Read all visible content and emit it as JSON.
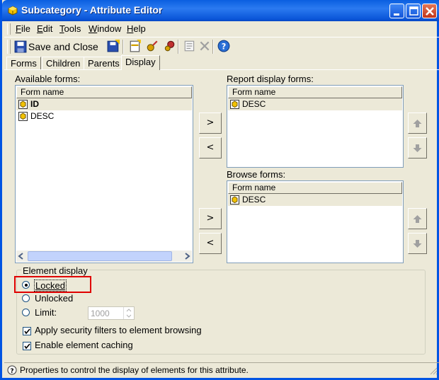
{
  "window": {
    "title": "Subcategory - Attribute Editor",
    "title_icon": "cube-icon",
    "controls": [
      "minimize-icon",
      "maximize-icon",
      "close-icon"
    ]
  },
  "menubar": {
    "items": [
      {
        "label": "File",
        "mnemonic": "F"
      },
      {
        "label": "Edit",
        "mnemonic": "E"
      },
      {
        "label": "Tools",
        "mnemonic": "T"
      },
      {
        "label": "Window",
        "mnemonic": "W"
      },
      {
        "label": "Help",
        "mnemonic": "H"
      }
    ]
  },
  "toolbar": {
    "save_close_label": "Save and Close",
    "icons": [
      "save-icon",
      "save-as-icon",
      "new-form-icon",
      "attribute-icon",
      "relationship-icon",
      "properties-icon",
      "delete-icon",
      "help-icon"
    ]
  },
  "tabs": [
    {
      "label": "Forms"
    },
    {
      "label": "Children"
    },
    {
      "label": "Parents"
    },
    {
      "label": "Display",
      "active": true
    }
  ],
  "available_forms": {
    "label": "Available forms:",
    "column": "Form name",
    "rows": [
      {
        "name": "ID",
        "selected": true,
        "bold": true
      },
      {
        "name": "DESC",
        "selected": false,
        "bold": false
      }
    ]
  },
  "report_display_forms": {
    "label": "Report display forms:",
    "column": "Form name",
    "rows": [
      {
        "name": "DESC",
        "selected": true
      }
    ]
  },
  "browse_forms": {
    "label": "Browse forms:",
    "column": "Form name",
    "rows": [
      {
        "name": "DESC",
        "selected": true
      }
    ]
  },
  "buttons": {
    "add_report": ">",
    "remove_report": "<",
    "add_browse": ">",
    "remove_browse": "<"
  },
  "element_display": {
    "legend": "Element display",
    "options": [
      {
        "label": "Locked",
        "selected": true
      },
      {
        "label": "Unlocked",
        "selected": false
      },
      {
        "label": "Limit:",
        "selected": false
      }
    ],
    "limit_value": "1000",
    "apply_security_label": "Apply security filters to element browsing",
    "apply_security_checked": true,
    "enable_caching_label": "Enable element caching",
    "enable_caching_checked": true
  },
  "statusbar": {
    "text": "Properties to control the display of elements for this attribute."
  },
  "colors": {
    "titlebar": "#0a5fe0",
    "face": "#ece9d8",
    "highlight_box": "#e00000"
  }
}
